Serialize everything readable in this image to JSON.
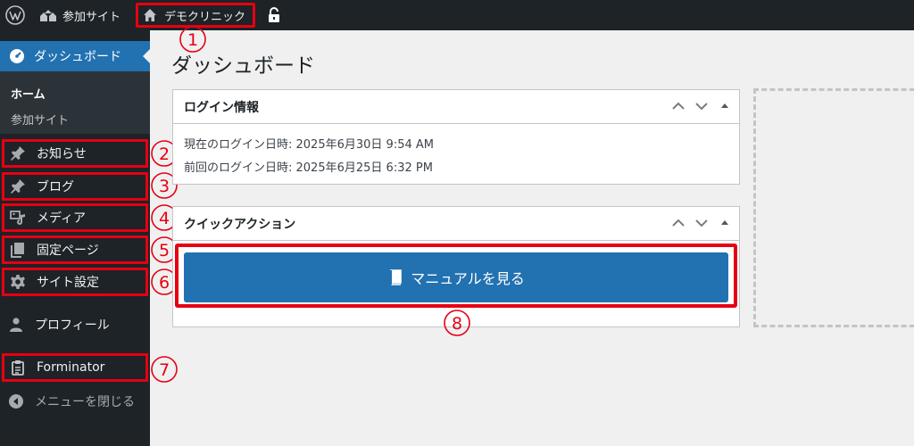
{
  "adminbar": {
    "site_name": "参加サイト",
    "clinic_name": "デモクリニック"
  },
  "sidebar": {
    "dashboard": "ダッシュボード",
    "sub_home": "ホーム",
    "sub_site": "参加サイト",
    "items": [
      {
        "label": "お知らせ",
        "icon": "pin-icon",
        "marker": "②"
      },
      {
        "label": "ブログ",
        "icon": "pin-icon",
        "marker": "③"
      },
      {
        "label": "メディア",
        "icon": "media-icon",
        "marker": "④"
      },
      {
        "label": "固定ページ",
        "icon": "page-icon",
        "marker": "⑤"
      },
      {
        "label": "サイト設定",
        "icon": "gear-icon",
        "marker": "⑥"
      }
    ],
    "profile": "プロフィール",
    "forminator": "Forminator",
    "forminator_marker": "⑦",
    "collapse": "メニューを閉じる"
  },
  "main": {
    "title": "ダッシュボード",
    "login_box": {
      "title": "ログイン情報",
      "current": "現在のログイン日時: 2025年6月30日 9:54 AM",
      "previous": "前回のログイン日時: 2025年6月25日 6:32 PM"
    },
    "quick_box": {
      "title": "クイックアクション",
      "button": "マニュアルを見る"
    }
  },
  "markers": {
    "clinic": "①",
    "button": "⑧"
  },
  "colors": {
    "bar": "#1d2327",
    "accent": "#2271b1",
    "highlight": "#e60012"
  }
}
